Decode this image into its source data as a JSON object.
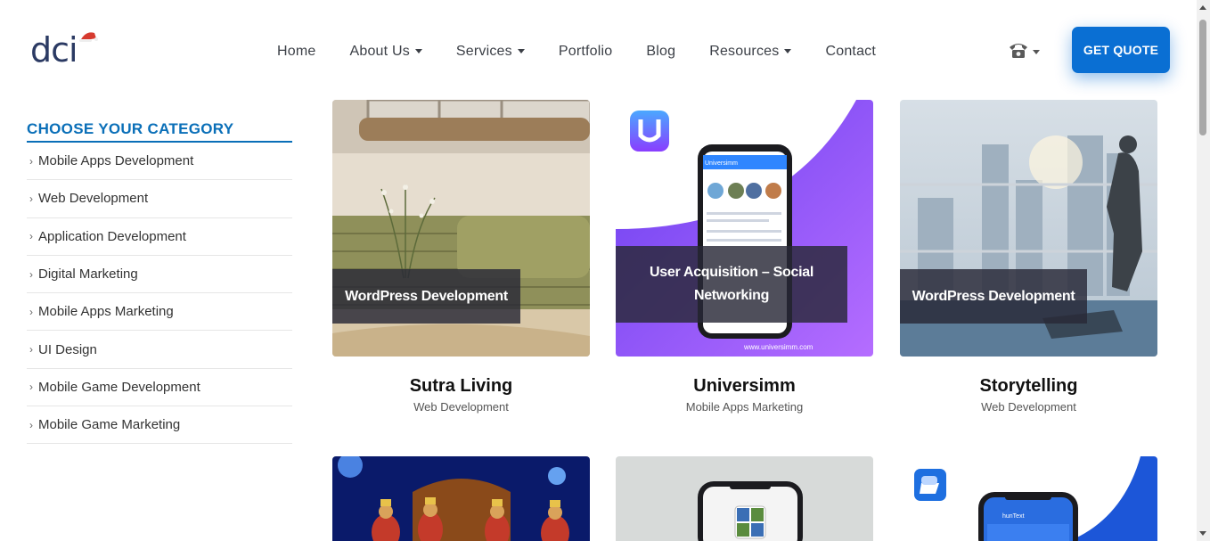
{
  "logo": {
    "text": "dci"
  },
  "nav": {
    "items": [
      {
        "label": "Home",
        "dropdown": false
      },
      {
        "label": "About Us",
        "dropdown": true
      },
      {
        "label": "Services",
        "dropdown": true
      },
      {
        "label": "Portfolio",
        "dropdown": false
      },
      {
        "label": "Blog",
        "dropdown": false
      },
      {
        "label": "Resources",
        "dropdown": true
      },
      {
        "label": "Contact",
        "dropdown": false
      }
    ],
    "phone_icon": "phone-icon",
    "quote_label": "GET QUOTE"
  },
  "sidebar": {
    "title": "CHOOSE YOUR CATEGORY",
    "items": [
      {
        "label": "Mobile Apps Development"
      },
      {
        "label": "Web Development"
      },
      {
        "label": "Application Development"
      },
      {
        "label": "Digital Marketing"
      },
      {
        "label": "Mobile Apps Marketing"
      },
      {
        "label": "UI Design"
      },
      {
        "label": "Mobile Game Development"
      },
      {
        "label": "Mobile Game Marketing"
      }
    ]
  },
  "portfolio": {
    "cards": [
      {
        "overlay": "WordPress Development",
        "title": "Sutra Living",
        "category": "Web Development"
      },
      {
        "overlay": "User Acquisition – Social Networking",
        "title": "Universimm",
        "category": "Mobile Apps Marketing",
        "thumb_caption": "www.universimm.com",
        "app_name": "Universimm"
      },
      {
        "overlay": "WordPress Development",
        "title": "Storytelling",
        "category": "Web Development"
      },
      {
        "overlay": "",
        "title": "",
        "category": ""
      },
      {
        "overlay": "",
        "title": "",
        "category": ""
      },
      {
        "overlay": "",
        "title": "",
        "category": "",
        "app_name": "hunText"
      }
    ]
  },
  "colors": {
    "brand_blue": "#0a6fd3",
    "heading_blue": "#0a6fb8",
    "logo_navy": "#2b3a63",
    "logo_red": "#d63a2f"
  }
}
